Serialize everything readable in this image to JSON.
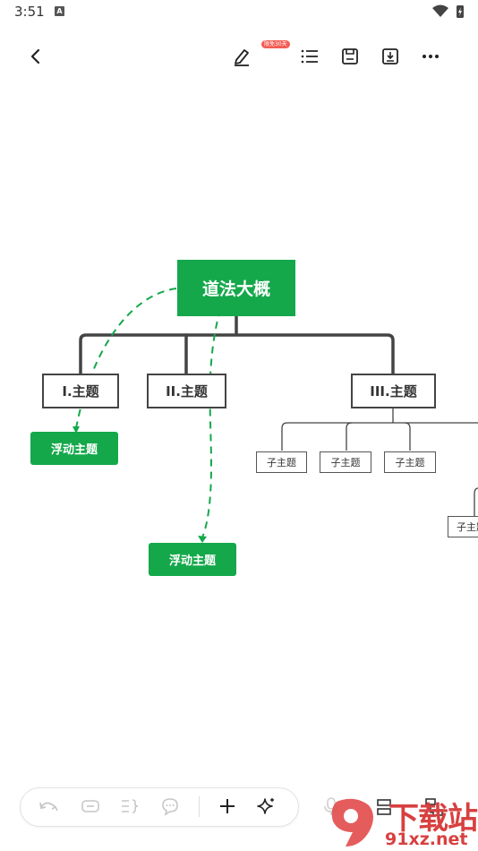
{
  "status_bar": {
    "time": "3:51",
    "notif_letter": "A"
  },
  "toolbar": {
    "badge": "限免30天"
  },
  "mindmap": {
    "root": "道法大概",
    "topics": [
      "I.主题",
      "II.主题",
      "III.主题"
    ],
    "subtopics": [
      "子主题",
      "子主题",
      "子主题",
      "子主题"
    ],
    "floating": [
      "浮动主题",
      "浮动主题"
    ]
  },
  "watermark": {
    "line1": "下载站",
    "line2": "91xz.net"
  },
  "colors": {
    "accent": "#14a84b",
    "connector": "#444444",
    "badge": "#f25c54"
  }
}
